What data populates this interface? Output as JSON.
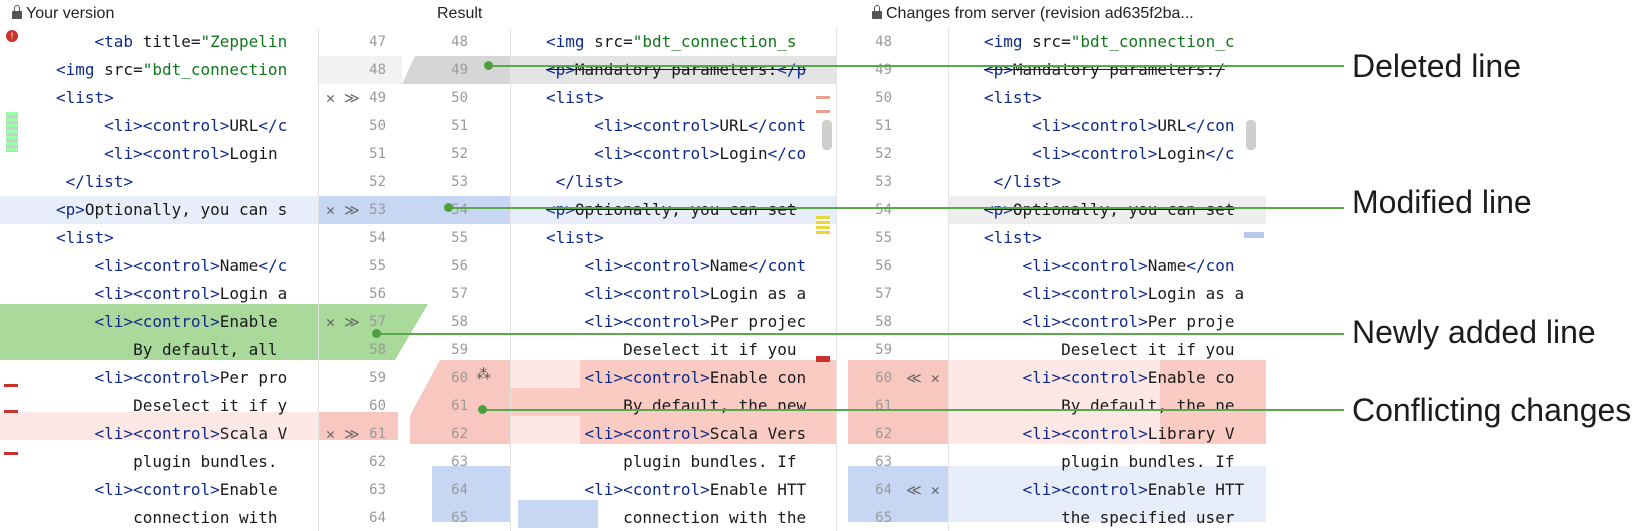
{
  "headers": {
    "left": "Your version",
    "center": "Result",
    "right": "Changes from server (revision ad635f2ba..."
  },
  "left_lines": [
    {
      "n": "47",
      "code": "    <tab title=\"Zeppelin"
    },
    {
      "n": "48",
      "code": "<img src=\"bdt_connection"
    },
    {
      "n": "49",
      "code": "<list>"
    },
    {
      "n": "50",
      "code": "     <li><control>URL</c"
    },
    {
      "n": "51",
      "code": "     <li><control>Login<"
    },
    {
      "n": "52",
      "code": " </list>"
    },
    {
      "n": "53",
      "code": "<p>Optionally, you can s"
    },
    {
      "n": "54",
      "code": "<list>"
    },
    {
      "n": "55",
      "code": "    <li><control>Name</c"
    },
    {
      "n": "56",
      "code": "    <li><control>Login a"
    },
    {
      "n": "57",
      "code": "    <li><control>Enable "
    },
    {
      "n": "58",
      "code": "        By default, all"
    },
    {
      "n": "59",
      "code": "    <li><control>Per pro"
    },
    {
      "n": "60",
      "code": "        Deselect it if y"
    },
    {
      "n": "61",
      "code": "    <li><control>Scala V"
    },
    {
      "n": "62",
      "code": "        plugin bundles."
    },
    {
      "n": "63",
      "code": "    <li><control>Enable "
    },
    {
      "n": "64",
      "code": "        connection with"
    }
  ],
  "center_lines": [
    {
      "n": "48",
      "code": "<img src=\"bdt_connection_s"
    },
    {
      "n": "49",
      "code": "<p>Mandatory parameters:</p"
    },
    {
      "n": "50",
      "code": "<list>"
    },
    {
      "n": "51",
      "code": "     <li><control>URL</cont"
    },
    {
      "n": "52",
      "code": "     <li><control>Login</co"
    },
    {
      "n": "53",
      "code": " </list>"
    },
    {
      "n": "54",
      "code": "<p>Optionally, you can set"
    },
    {
      "n": "55",
      "code": "<list>"
    },
    {
      "n": "56",
      "code": "    <li><control>Name</cont"
    },
    {
      "n": "57",
      "code": "    <li><control>Login as a"
    },
    {
      "n": "58",
      "code": "    <li><control>Per projec"
    },
    {
      "n": "59",
      "code": "        Deselect it if you"
    },
    {
      "n": "60",
      "code": "    <li><control>Enable con"
    },
    {
      "n": "61",
      "code": "        By default, the new"
    },
    {
      "n": "62",
      "code": "    <li><control>Scala Vers"
    },
    {
      "n": "63",
      "code": "        plugin bundles. If"
    },
    {
      "n": "64",
      "code": "    <li><control>Enable HTT"
    },
    {
      "n": "65",
      "code": "        connection with the"
    }
  ],
  "right_lines": [
    {
      "n": "48",
      "code": "<img src=\"bdt_connection_c"
    },
    {
      "n": "49",
      "code": "<p>Mandatory parameters:</"
    },
    {
      "n": "50",
      "code": "<list>"
    },
    {
      "n": "51",
      "code": "     <li><control>URL</con"
    },
    {
      "n": "52",
      "code": "     <li><control>Login</c"
    },
    {
      "n": "53",
      "code": " </list>"
    },
    {
      "n": "54",
      "code": "<p>Optionally, you can set"
    },
    {
      "n": "55",
      "code": "<list>"
    },
    {
      "n": "56",
      "code": "    <li><control>Name</con"
    },
    {
      "n": "57",
      "code": "    <li><control>Login as a"
    },
    {
      "n": "58",
      "code": "    <li><control>Per proje"
    },
    {
      "n": "59",
      "code": "        Deselect it if you"
    },
    {
      "n": "60",
      "code": "    <li><control>Enable co"
    },
    {
      "n": "61",
      "code": "        By default, the ne"
    },
    {
      "n": "62",
      "code": "    <li><control>Library V"
    },
    {
      "n": "63",
      "code": "        plugin bundles. If"
    },
    {
      "n": "64",
      "code": "    <li><control>Enable HTT"
    },
    {
      "n": "65",
      "code": "        the specified user"
    }
  ],
  "left_actions": [
    {
      "row": 2,
      "text": "✕ ≫"
    },
    {
      "row": 6,
      "text": "✕ ≫"
    },
    {
      "row": 10,
      "text": "✕ ≫"
    },
    {
      "row": 14,
      "text": "✕ ≫"
    }
  ],
  "right_actions": [
    {
      "row": 12,
      "text": "≪ ✕"
    },
    {
      "row": 16,
      "text": "≪ ✕"
    }
  ],
  "magic_icon": "magic-wand-icon",
  "annotations": {
    "deleted": "Deleted line",
    "modified": "Modified line",
    "added": "Newly added line",
    "conflict": "Conflicting changes"
  },
  "colors": {
    "deleted": "#d7d7d7",
    "modified": "#dde7f7",
    "modified_strong": "#c5d6f2",
    "added": "#a8d89a",
    "conflict": "#f8c8c0",
    "conflict_light": "#fde8e5",
    "callout": "#5aa84d"
  }
}
